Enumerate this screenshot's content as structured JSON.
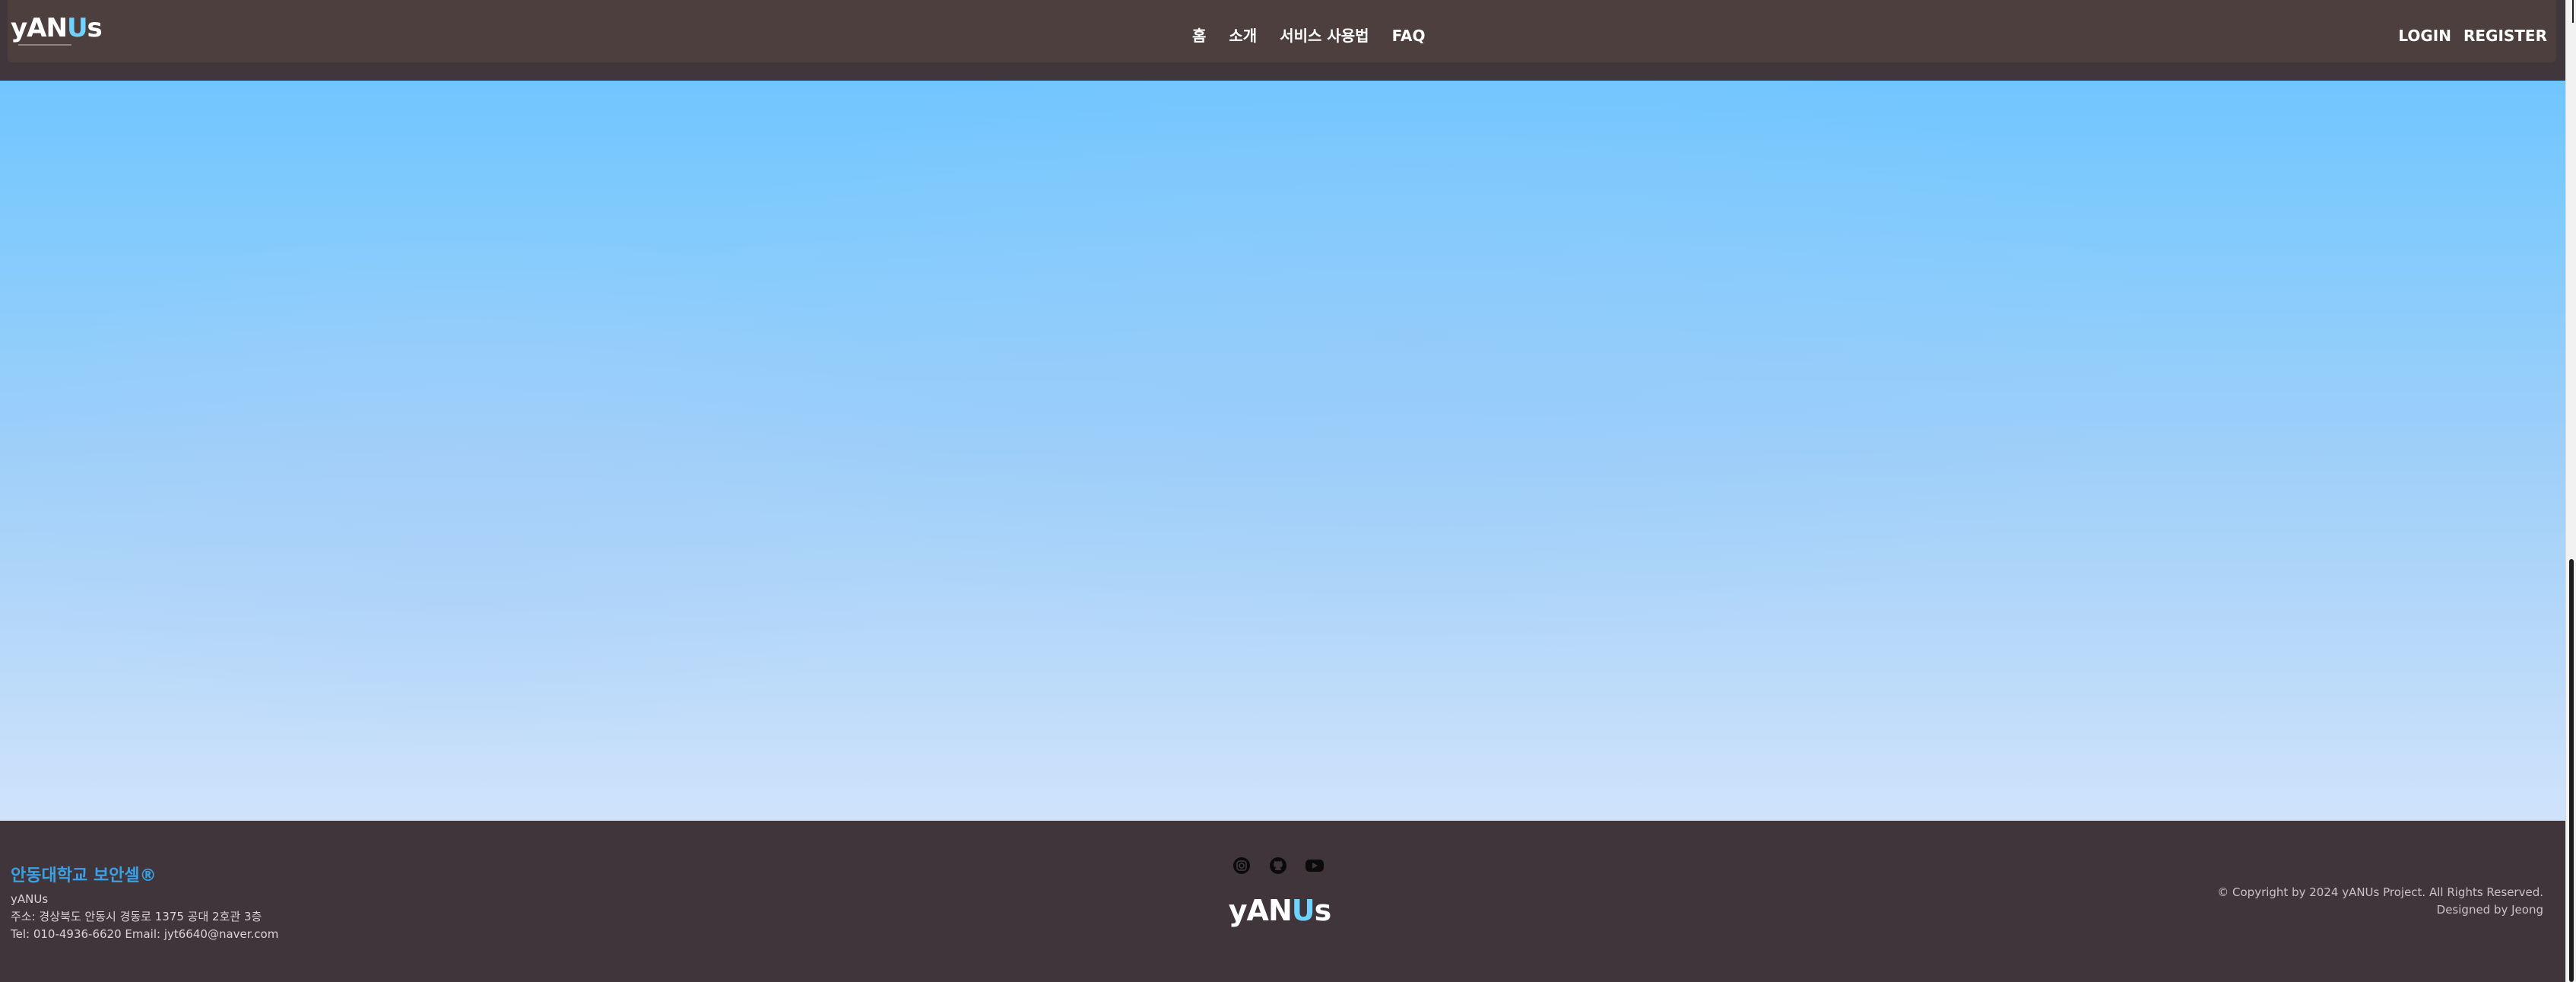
{
  "header": {
    "logo_text_a": "yAN",
    "logo_text_b": "U",
    "logo_text_c": "s",
    "nav": [
      {
        "label": "홈"
      },
      {
        "label": "소개"
      },
      {
        "label": "서비스 사용법"
      },
      {
        "label": "FAQ"
      }
    ],
    "login_label": "LOGIN",
    "register_label": "REGISTER"
  },
  "footer": {
    "brand": "안동대학교 보안셀®",
    "name": "yANUs",
    "address": "주소: 경상북도 안동시 경동로 1375 공대 2호관 3층",
    "contact": "Tel: 010-4936-6620 Email: jyt6640@naver.com",
    "social_icons": [
      "instagram-icon",
      "github-icon",
      "youtube-icon"
    ],
    "logo_text_a": "yAN",
    "logo_text_b": "U",
    "logo_text_c": "s",
    "copyright": "© Copyright by 2024 yANUs Project. All Rights Reserved.",
    "designer": "Designed by Jeong"
  },
  "colors": {
    "header_bg": "#4e3f3f",
    "footer_bg": "#3f353b",
    "brand_accent": "#3aa1e6",
    "logo_accent": "#6fd3ff"
  }
}
